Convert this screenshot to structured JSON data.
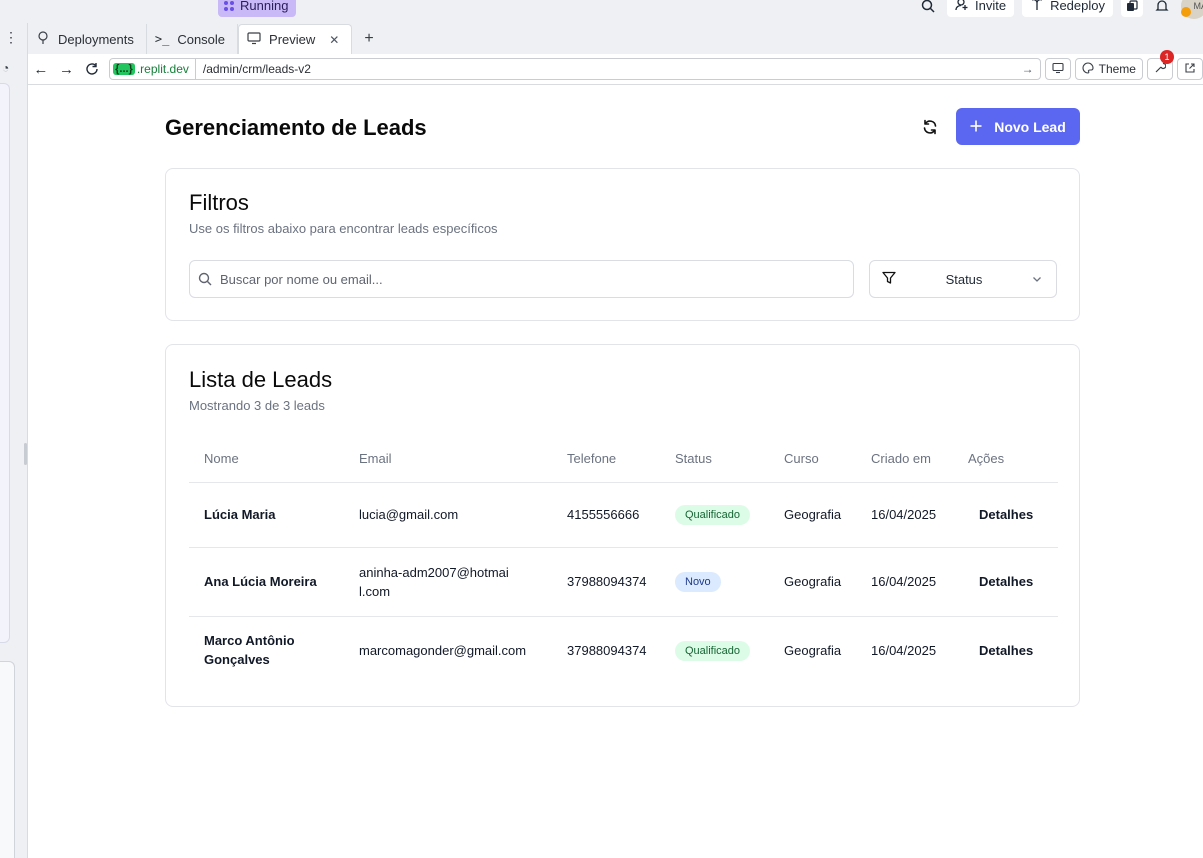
{
  "replit": {
    "run_status": "Running",
    "invite_label": "Invite",
    "redeploy_label": "Redeploy",
    "avatar_initials": "MA",
    "tabs": [
      {
        "label": "Deployments",
        "icon": "deployments-icon"
      },
      {
        "label": "Console",
        "icon": "terminal-icon"
      },
      {
        "label": "Preview",
        "icon": "monitor-icon",
        "active": true
      }
    ],
    "url_host": ".replit.dev",
    "url_host_badge": "{...}",
    "url_path": "/admin/crm/leads-v2",
    "theme_label": "Theme",
    "notification_count": "1"
  },
  "page": {
    "title": "Gerenciamento de Leads",
    "new_lead_label": "Novo Lead"
  },
  "filters": {
    "title": "Filtros",
    "subtitle": "Use os filtros abaixo para encontrar leads específicos",
    "search_placeholder": "Buscar por nome ou email...",
    "status_label": "Status"
  },
  "leads": {
    "title": "Lista de Leads",
    "subtitle": "Mostrando 3 de 3 leads",
    "columns": [
      "Nome",
      "Email",
      "Telefone",
      "Status",
      "Curso",
      "Criado em",
      "Ações"
    ],
    "rows": [
      {
        "name": "Lúcia Maria",
        "email": "lucia@gmail.com",
        "phone": "4155556666",
        "status": "Qualificado",
        "course": "Geografia",
        "created": "16/04/2025",
        "action": "Detalhes"
      },
      {
        "name": "Ana Lúcia Moreira",
        "email": "aninha-adm2007@hotmail.com",
        "phone": "37988094374",
        "status": "Novo",
        "course": "Geografia",
        "created": "16/04/2025",
        "action": "Detalhes"
      },
      {
        "name": "Marco Antônio Gonçalves",
        "email": "marcomagonder@gmail.com",
        "phone": "37988094374",
        "status": "Qualificado",
        "course": "Geografia",
        "created": "16/04/2025",
        "action": "Detalhes"
      }
    ]
  },
  "colors": {
    "primary": "#5b67f1",
    "qualified_bg": "#dcfce7",
    "new_bg": "#dbeafe"
  }
}
